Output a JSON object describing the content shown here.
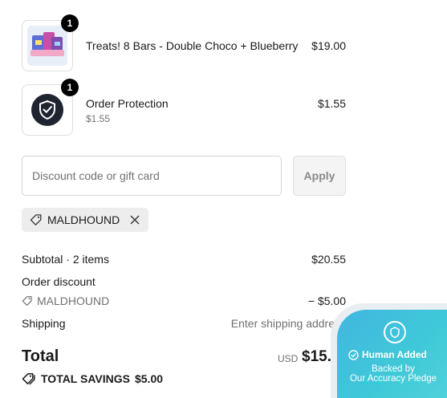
{
  "line_items": [
    {
      "name": "Treats! 8 Bars - Double Choco + Blueberry",
      "sub": "",
      "price": "$19.00",
      "quantity": "1",
      "thumb_icon": "product-photo"
    },
    {
      "name": "Order Protection",
      "sub": "$1.55",
      "price": "$1.55",
      "quantity": "1",
      "thumb_icon": "shield-check-icon"
    }
  ],
  "discount": {
    "placeholder": "Discount code or gift card",
    "apply_label": "Apply",
    "applied_code": "MALDHOUND"
  },
  "summary": {
    "subtotal_label": "Subtotal · 2 items",
    "subtotal_value": "$20.55",
    "order_discount_label": "Order discount",
    "discount_code": "MALDHOUND",
    "discount_value": "− $5.00",
    "shipping_label": "Shipping",
    "shipping_value": "Enter shipping address"
  },
  "total": {
    "label": "Total",
    "currency": "USD",
    "value": "$15.55",
    "savings_label": "TOTAL SAVINGS",
    "savings_value": "$5.00"
  },
  "badge": {
    "title": "Human Added",
    "subtitle_line1": "Backed by",
    "subtitle_line2": "Our Accuracy Pledge",
    "color_start": "#41b6e0",
    "color_end": "#53d3dc"
  }
}
